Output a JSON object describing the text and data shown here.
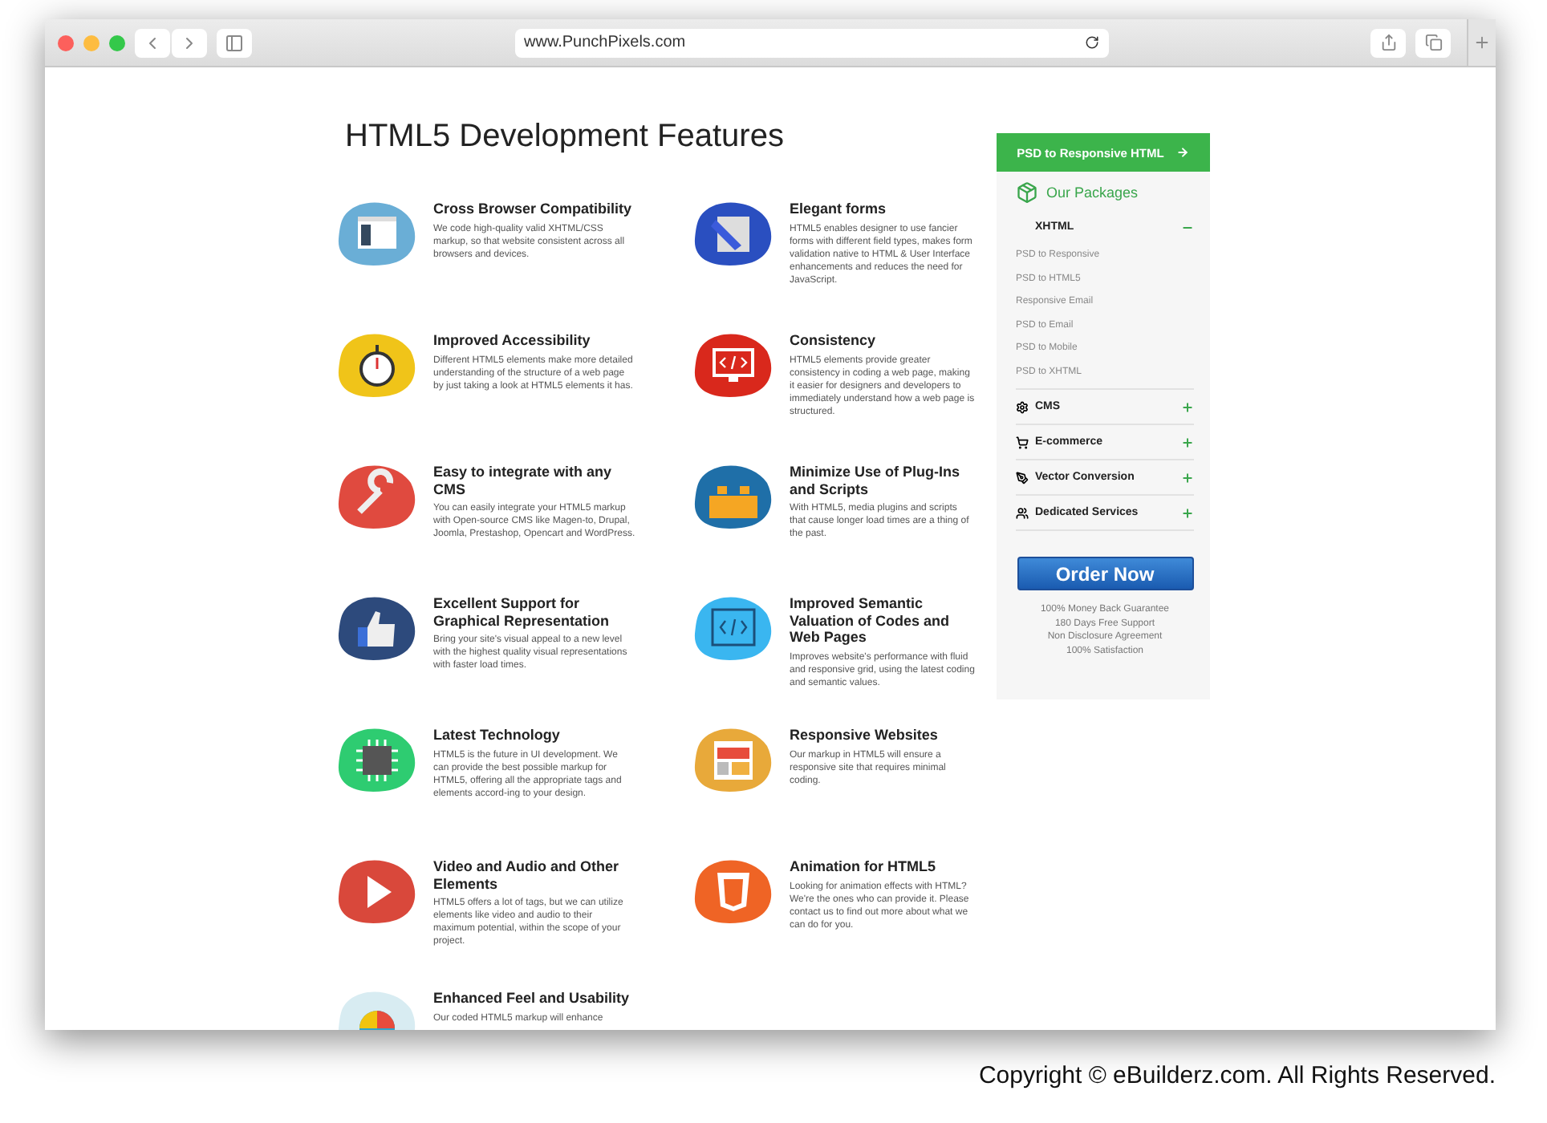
{
  "browser": {
    "url": "www.PunchPixels.com"
  },
  "page": {
    "title": "HTML5 Development Features"
  },
  "features": [
    {
      "title": "Cross Browser Compatibility",
      "text": "We code high-quality valid XHTML/CSS markup, so that website consistent across all browsers and devices.",
      "color": "#6aaed6"
    },
    {
      "title": "Elegant forms",
      "text": "HTML5 enables designer to use fancier forms with different field types, makes form validation native to HTML & User Interface enhancements and reduces the need for JavaScript.",
      "color": "#2a4fc0"
    },
    {
      "title": "Improved Accessibility",
      "text": "Different HTML5 elements make more detailed understanding of the structure of a web page by just taking a look at HTML5 elements it has.",
      "color": "#f0c419"
    },
    {
      "title": "Consistency",
      "text": "HTML5 elements provide greater consistency in coding a web page, making it easier for designers and developers to immediately understand how a web page is structured.",
      "color": "#d9281c"
    },
    {
      "title": "Easy to integrate with any CMS",
      "text": "You can easily integrate your HTML5 markup with Open-source CMS like Magen-to, Drupal, Joomla, Prestashop, Opencart and WordPress.",
      "color": "#e04a3f"
    },
    {
      "title": "Minimize Use of Plug-Ins and Scripts",
      "text": "With HTML5, media plugins and scripts that cause longer load times are a thing of the past.",
      "color": "#1f6fa8"
    },
    {
      "title": "Excellent Support for Graphical Representation",
      "text": "Bring your site's visual appeal to a new level with the highest quality visual representations with faster load times.",
      "color": "#2d4a7c"
    },
    {
      "title": "Improved Semantic Valuation of Codes and Web Pages",
      "text": "Improves website's performance with fluid and responsive grid, using the latest coding and semantic values.",
      "color": "#3ab6f0"
    },
    {
      "title": "Latest Technology",
      "text": "HTML5 is the future in UI development. We can provide the best possible markup for HTML5, offering all the appropriate tags and elements accord-ing to your design.",
      "color": "#2ecc71"
    },
    {
      "title": "Responsive Websites",
      "text": "Our markup in HTML5 will ensure a responsive site that requires minimal coding.",
      "color": "#e8a93a"
    },
    {
      "title": "Video and Audio and Other Elements",
      "text": "HTML5 offers a lot of tags, but we can utilize elements like video and audio to their maximum potential, within the scope of your project.",
      "color": "#d9483b"
    },
    {
      "title": "Animation for HTML5",
      "text": "Looking for animation effects with HTML? We're the ones who can provide it. Please contact us to find out more about what we can do for you.",
      "color": "#ef6425"
    },
    {
      "title": "Enhanced Feel and Usability",
      "text": "Our coded HTML5 markup will enhance",
      "color": "#d8ecf2"
    }
  ],
  "sidebar": {
    "cta": "PSD to Responsive HTML",
    "packages_title": "Our Packages",
    "packages": [
      {
        "label": "XHTML",
        "expanded": true,
        "children": [
          "PSD to Responsive",
          "PSD to HTML5",
          "Responsive Email",
          "PSD to Email",
          "PSD to Mobile",
          "PSD to XHTML"
        ]
      },
      {
        "label": "CMS",
        "expanded": false
      },
      {
        "label": "E-commerce",
        "expanded": false
      },
      {
        "label": "Vector Conversion",
        "expanded": false
      },
      {
        "label": "Dedicated Services",
        "expanded": false
      }
    ],
    "order_button": "Order Now",
    "guarantees": [
      "100% Money Back Guarantee",
      "180 Days Free Support",
      "Non Disclosure Agreement",
      "100% Satisfaction"
    ]
  },
  "copyright": "Copyright © eBuilderz.com. All Rights Reserved."
}
